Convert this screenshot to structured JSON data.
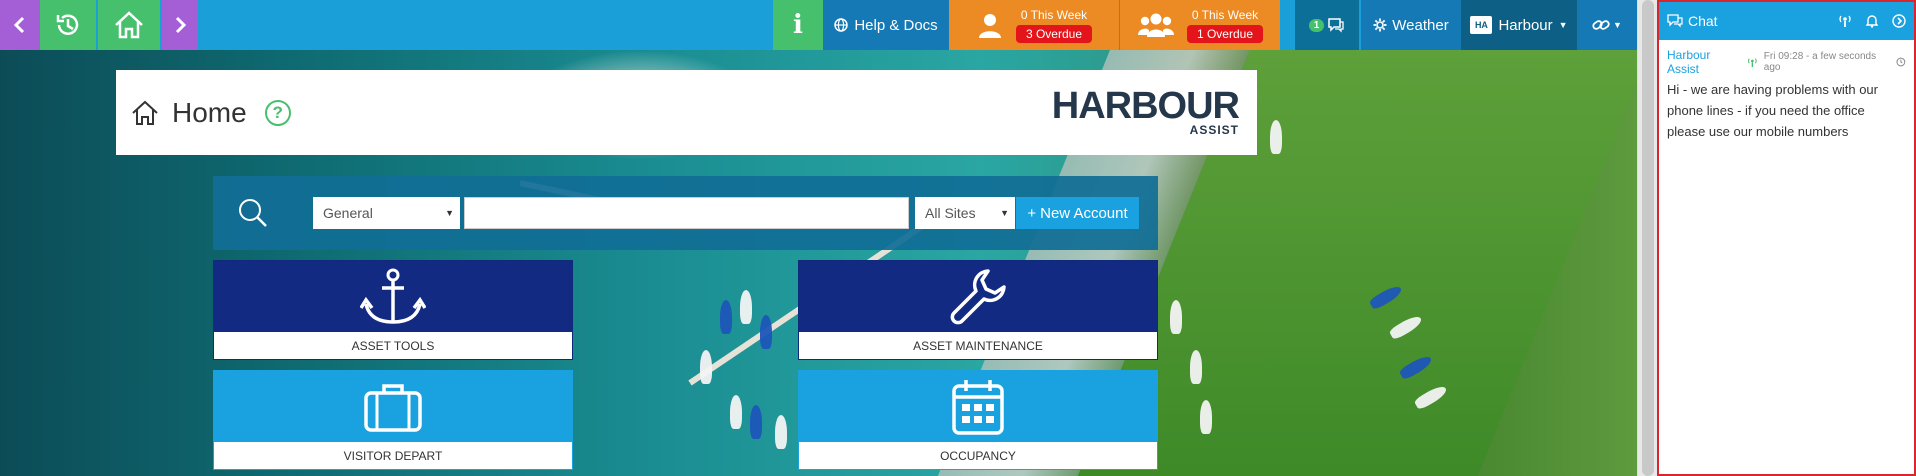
{
  "topbar": {
    "info_label": "i",
    "help_label": "Help & Docs",
    "visitors_week": "0 This Week",
    "visitors_overdue": "3 Overdue",
    "groups_week": "0 This Week",
    "groups_overdue": "1 Overdue",
    "chat_count": "1",
    "weather_label": "Weather",
    "harbour_logo_text": "HA",
    "harbour_label": "Harbour",
    "icons": [
      "chevron-left-icon",
      "history-icon",
      "home-icon",
      "chevron-right-icon",
      "info-icon",
      "globe-icon",
      "user-icon",
      "users-icon",
      "comments-icon",
      "gear-icon",
      "link-icon"
    ]
  },
  "page": {
    "title": "Home",
    "help_symbol": "?",
    "brand_main": "HARBOUR",
    "brand_sub": "ASSIST"
  },
  "search": {
    "category_value": "General",
    "query_value": "",
    "sites_value": "All Sites",
    "new_account_label": "New Account"
  },
  "tiles": [
    {
      "label": "ASSET TOOLS",
      "icon": "anchor-icon",
      "color": "#122a82"
    },
    {
      "label": "ASSET MAINTENANCE",
      "icon": "wrench-icon",
      "color": "#122a82"
    },
    {
      "label": "VISITOR DEPART",
      "icon": "suitcase-icon",
      "color": "#1aa1e0"
    },
    {
      "label": "OCCUPANCY",
      "icon": "calendar-icon",
      "color": "#1aa1e0"
    }
  ],
  "chat": {
    "title": "Chat",
    "messages": [
      {
        "author": "Harbour Assist",
        "time": "Fri 09:28 - a few seconds ago",
        "text": "Hi - we are having problems with our phone lines - if you need the office please use our mobile numbers"
      }
    ]
  },
  "colors": {
    "purple": "#a45fd6",
    "green": "#46c06c",
    "blue": "#1a9fd9",
    "orange": "#ec8a24",
    "navy": "#122a82",
    "overdue_red": "#e3151a",
    "chat_border": "#d9262c"
  }
}
